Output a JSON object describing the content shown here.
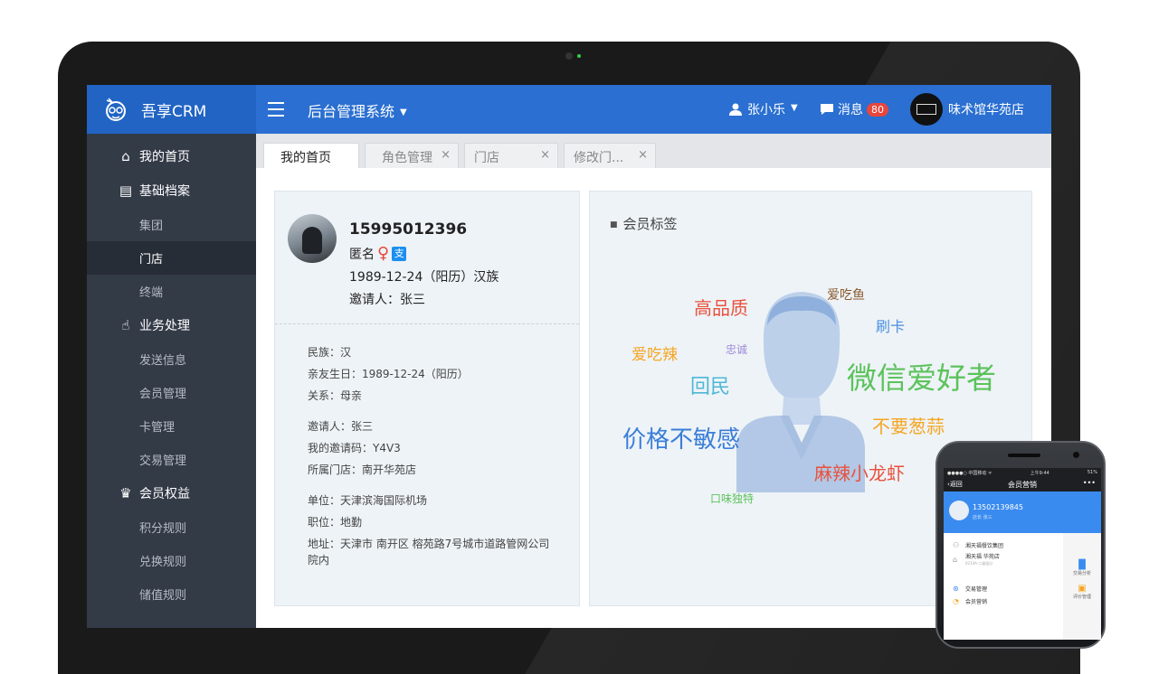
{
  "app": {
    "brand_name": "吾享CRM",
    "system_title": "后台管理系统"
  },
  "header": {
    "user_name": "张小乐",
    "messages_label": "消息",
    "messages_count": "80",
    "store_name": "味术馆华苑店"
  },
  "sidebar": {
    "groups": [
      {
        "label": "我的首页",
        "icon": "home-icon"
      },
      {
        "label": "基础档案",
        "icon": "document-icon",
        "items": [
          "集团",
          "门店",
          "终端"
        ]
      },
      {
        "label": "业务处理",
        "icon": "hand-pointer-icon",
        "items": [
          "发送信息",
          "会员管理",
          "卡管理",
          "交易管理"
        ]
      },
      {
        "label": "会员权益",
        "icon": "crown-icon",
        "items": [
          "积分规则",
          "兑换规则",
          "储值规则"
        ]
      }
    ],
    "active_item": "门店"
  },
  "tabs": [
    {
      "label": "我的首页",
      "active": true,
      "closable": false
    },
    {
      "label": "角色管理",
      "active": false,
      "closable": true
    },
    {
      "label": "门店",
      "active": false,
      "closable": true
    },
    {
      "label": "修改门...",
      "active": false,
      "closable": true
    }
  ],
  "tab_close_symbol": "×",
  "profile": {
    "phone": "15995012396",
    "name": "匿名",
    "gender_symbol": "♀",
    "alipay_symbol": "支",
    "birth": "1989-12-24（阳历）汉族",
    "inviter": "邀请人：张三",
    "details": [
      "民族：汉",
      "亲友生日：1989-12-24（阳历）",
      "关系：母亲",
      "邀请人：张三",
      "我的邀请码：Y4V3",
      "所属门店：南开华苑店",
      "单位：天津滨海国际机场",
      "职位：地勤",
      "地址：天津市 南开区 榕苑路7号城市道路管网公司院内"
    ]
  },
  "tags_panel": {
    "title": "会员标签",
    "tags": [
      {
        "text": "高品质",
        "color": "#e8513c"
      },
      {
        "text": "爱吃鱼",
        "color": "#8a5a2c"
      },
      {
        "text": "刷卡",
        "color": "#4a8fe0"
      },
      {
        "text": "爱吃辣",
        "color": "#f5a623"
      },
      {
        "text": "忠诚",
        "color": "#9b8ad6"
      },
      {
        "text": "回民",
        "color": "#4fb7d6"
      },
      {
        "text": "微信爱好者",
        "color": "#5cc35c"
      },
      {
        "text": "价格不敏感",
        "color": "#3a7ed8"
      },
      {
        "text": "不要葱蒜",
        "color": "#f5a623"
      },
      {
        "text": "麻辣小龙虾",
        "color": "#e8513c"
      },
      {
        "text": "口味独特",
        "color": "#5cc35c"
      }
    ]
  },
  "mobile": {
    "carrier": "●●●●○ 中国移动 ᯤ",
    "time": "上午9:44",
    "battery": "51%",
    "back_label": "返回",
    "title": "会员营销",
    "more": "•••",
    "phone": "13502139845",
    "role": "店长  张三",
    "rows": [
      {
        "label": "湘天福餐饮集团",
        "sub": ""
      },
      {
        "label": "湘天福 华苑店",
        "sub": "0210A-二级组分"
      },
      {
        "label": "交易管理",
        "sub": ""
      },
      {
        "label": "会员营销",
        "sub": ""
      }
    ],
    "side_items": [
      "交易分析",
      "评价管理"
    ]
  }
}
